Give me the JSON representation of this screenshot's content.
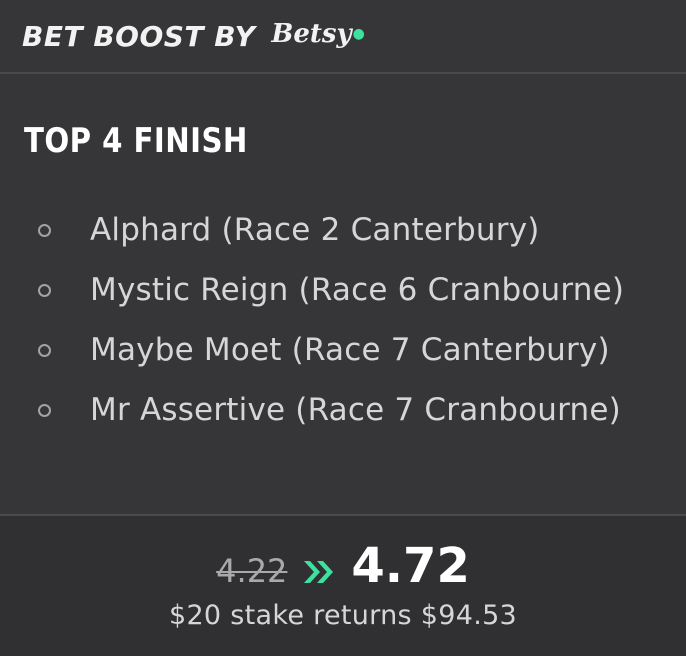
{
  "header": {
    "title": "BET BOOST BY",
    "brand": "Betsy"
  },
  "market": {
    "title": "TOP 4 FINISH",
    "selections": [
      {
        "label": "Alphard (Race 2 Canterbury)"
      },
      {
        "label": "Mystic Reign (Race 6 Cranbourne)"
      },
      {
        "label": "Maybe Moet (Race 7 Canterbury)"
      },
      {
        "label": "Mr Assertive (Race 7 Cranbourne)"
      }
    ]
  },
  "odds": {
    "previous": "4.22",
    "boosted": "4.72",
    "returns_text": "$20 stake returns $94.53"
  },
  "icons": {
    "bullet": "radio-circle-icon",
    "boost": "double-chevron-right-icon"
  },
  "colors": {
    "background": "#363638",
    "accent": "#3ee0a0",
    "text_primary": "#ffffff",
    "text_secondary": "#d6d6d8"
  }
}
